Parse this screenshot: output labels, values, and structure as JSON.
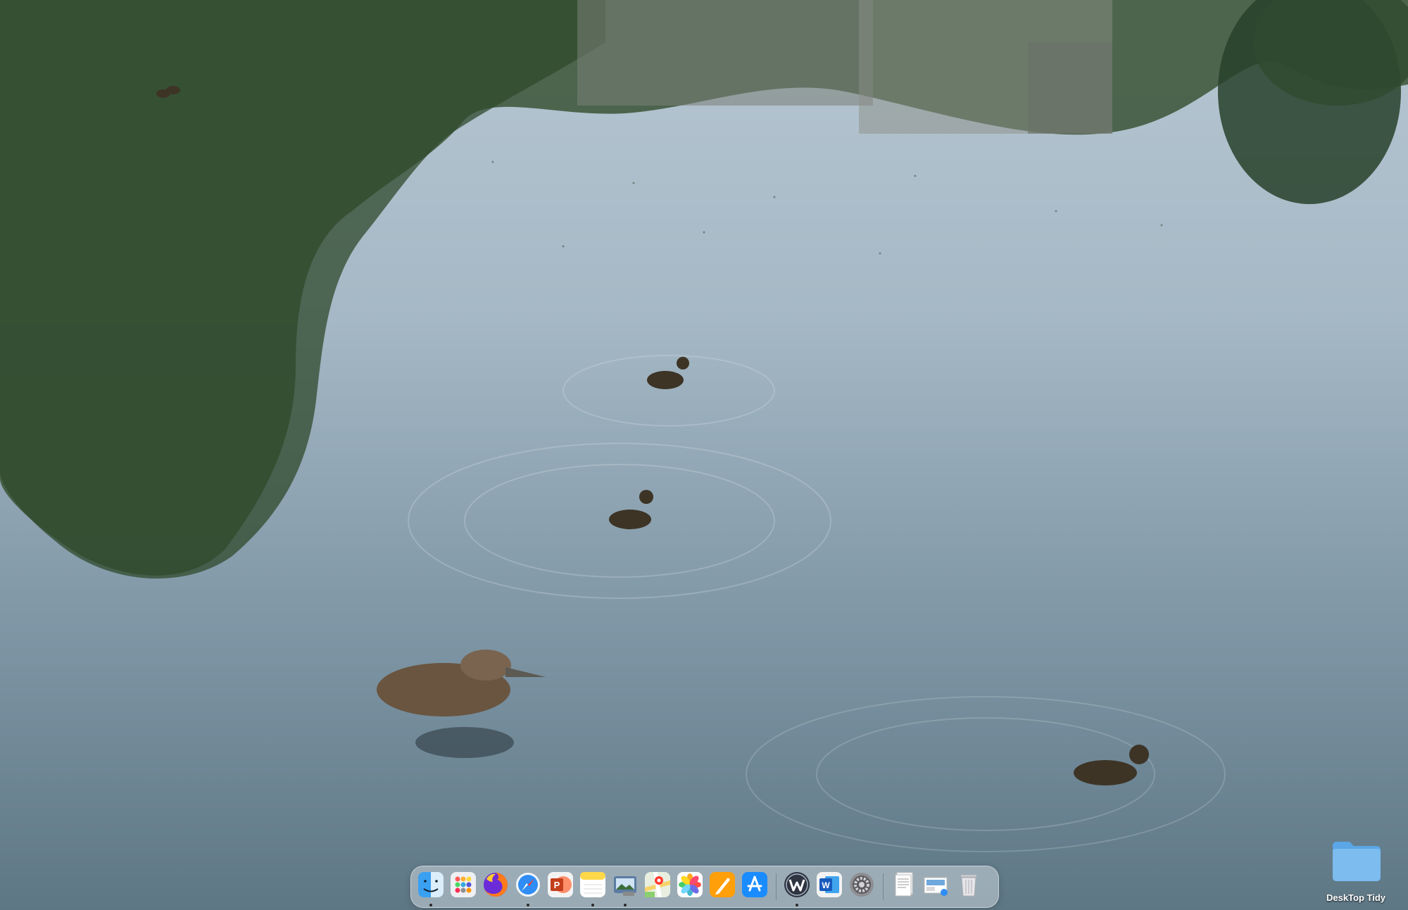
{
  "wallpaper": {
    "subject": "pond with mallard duck and ducklings",
    "colors": {
      "water": "#7f97a6",
      "reflection_green": "#3f5a3c",
      "sky_reflection": "#b9c9d4"
    }
  },
  "dock": {
    "apps": [
      {
        "name": "Finder",
        "icon": "finder-icon",
        "running": true
      },
      {
        "name": "Launchpad",
        "icon": "launchpad-icon",
        "running": false
      },
      {
        "name": "Firefox",
        "icon": "firefox-icon",
        "running": false
      },
      {
        "name": "Safari",
        "icon": "safari-icon",
        "running": true
      },
      {
        "name": "Microsoft PowerPoint",
        "icon": "powerpoint-icon",
        "running": false
      },
      {
        "name": "Notes",
        "icon": "notes-icon",
        "running": true
      },
      {
        "name": "Preview",
        "icon": "preview-icon",
        "running": true
      },
      {
        "name": "Maps",
        "icon": "maps-icon",
        "running": false
      },
      {
        "name": "Photos",
        "icon": "photos-icon",
        "running": false
      },
      {
        "name": "Pages",
        "icon": "pages-icon",
        "running": false
      },
      {
        "name": "App Store",
        "icon": "app-store-icon",
        "running": false
      },
      {
        "name": "WebCatalog",
        "icon": "w-app-icon",
        "running": true
      },
      {
        "name": "Microsoft Word",
        "icon": "word-icon",
        "running": false
      },
      {
        "name": "System Settings",
        "icon": "system-settings-icon",
        "running": false
      }
    ],
    "stack_items": [
      {
        "name": "Documents",
        "icon": "documents-stack-icon"
      },
      {
        "name": "Screenshots",
        "icon": "screenshots-stack-icon"
      },
      {
        "name": "Trash",
        "icon": "trash-icon"
      }
    ]
  },
  "desktop": {
    "folder": {
      "label": "DeskTop Tidy",
      "icon": "folder-icon",
      "color": "#7cbcef"
    }
  }
}
